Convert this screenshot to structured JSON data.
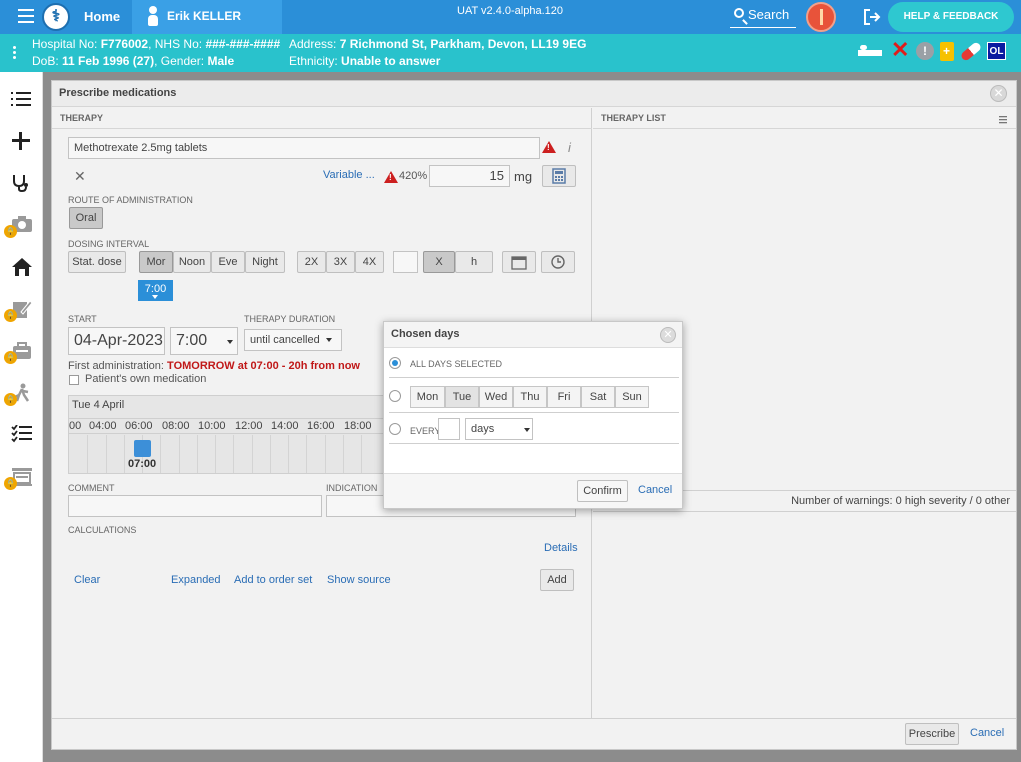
{
  "topbar": {
    "home_label": "Home",
    "patient_name": "Erik KELLER",
    "env_label": "UAT v2.4.0-alpha.120",
    "search_label": "Search",
    "help_label": "HELP & FEEDBACK"
  },
  "banner": {
    "hospital_no_label": "Hospital No:",
    "hospital_no": "F776002",
    "nhs_no_label": "NHS No:",
    "nhs_no": "###-###-####",
    "dob_label": "DoB:",
    "dob": "11 Feb 1996 (27)",
    "gender_label": "Gender:",
    "gender": "Male",
    "address_label": "Address:",
    "address": "7 Richmond St, Parkham, Devon, LL19 9EG",
    "ethnicity_label": "Ethnicity:",
    "ethnicity": "Unable to answer",
    "ol_badge": "OL"
  },
  "sidebar": {
    "items": [
      {
        "name": "list-icon",
        "locked": false
      },
      {
        "name": "plus-icon",
        "locked": false
      },
      {
        "name": "stethoscope-icon",
        "locked": false
      },
      {
        "name": "camera-icon",
        "locked": true
      },
      {
        "name": "home-icon",
        "locked": false
      },
      {
        "name": "edit-document-icon",
        "locked": true
      },
      {
        "name": "briefcase-icon",
        "locked": true
      },
      {
        "name": "activity-icon",
        "locked": true
      },
      {
        "name": "checklist-icon",
        "locked": false
      },
      {
        "name": "table-icon",
        "locked": true
      }
    ]
  },
  "modal": {
    "title": "Prescribe medications",
    "therapy_header": "THERAPY",
    "therapy_list_header": "THERAPY LIST",
    "medication": "Methotrexate 2.5mg tablets",
    "variable_label": "Variable ...",
    "percent": "420%",
    "dose_value": "15",
    "dose_unit": "mg",
    "route_label": "ROUTE OF ADMINISTRATION",
    "route_value": "Oral",
    "dosing_interval_label": "DOSING INTERVAL",
    "stat_dose": "Stat. dose",
    "times_of_day": [
      "Mor",
      "Noon",
      "Eve",
      "Night"
    ],
    "frequency_buttons": [
      "2X",
      "3X",
      "4X"
    ],
    "x_label": "X",
    "h_label": "h",
    "time_tag": "7:00",
    "start_label": "START",
    "start_date": "04-Apr-2023",
    "start_time": "7:00",
    "duration_label": "THERAPY DURATION",
    "duration_value": "until cancelled",
    "first_admin_label": "First administration:",
    "first_admin_value": "TOMORROW at 07:00 - 20h from now",
    "patients_own": "Patient's own medication",
    "timeline_date": "Tue 4 April",
    "timeline_hours": [
      "00",
      "04:00",
      "06:00",
      "08:00",
      "10:00",
      "12:00",
      "14:00",
      "16:00",
      "18:00"
    ],
    "timeline_dose": "07:00",
    "comment_label": "COMMENT",
    "indication_label": "INDICATION",
    "calculations_label": "CALCULATIONS",
    "details_link": "Details",
    "clear_link": "Clear",
    "expanded_link": "Expanded",
    "add_order_set_link": "Add to order set",
    "show_source_link": "Show source",
    "add_button": "Add",
    "warnings": "Number of warnings: 0 high severity / 0 other",
    "prescribe_button": "Prescribe",
    "cancel_link": "Cancel"
  },
  "chosen_days": {
    "title": "Chosen days",
    "all_days_label": "ALL DAYS SELECTED",
    "days": [
      "Mon",
      "Tue",
      "Wed",
      "Thu",
      "Fri",
      "Sat",
      "Sun"
    ],
    "every_label": "EVERY",
    "period_value": "days",
    "confirm_button": "Confirm",
    "cancel_link": "Cancel"
  }
}
